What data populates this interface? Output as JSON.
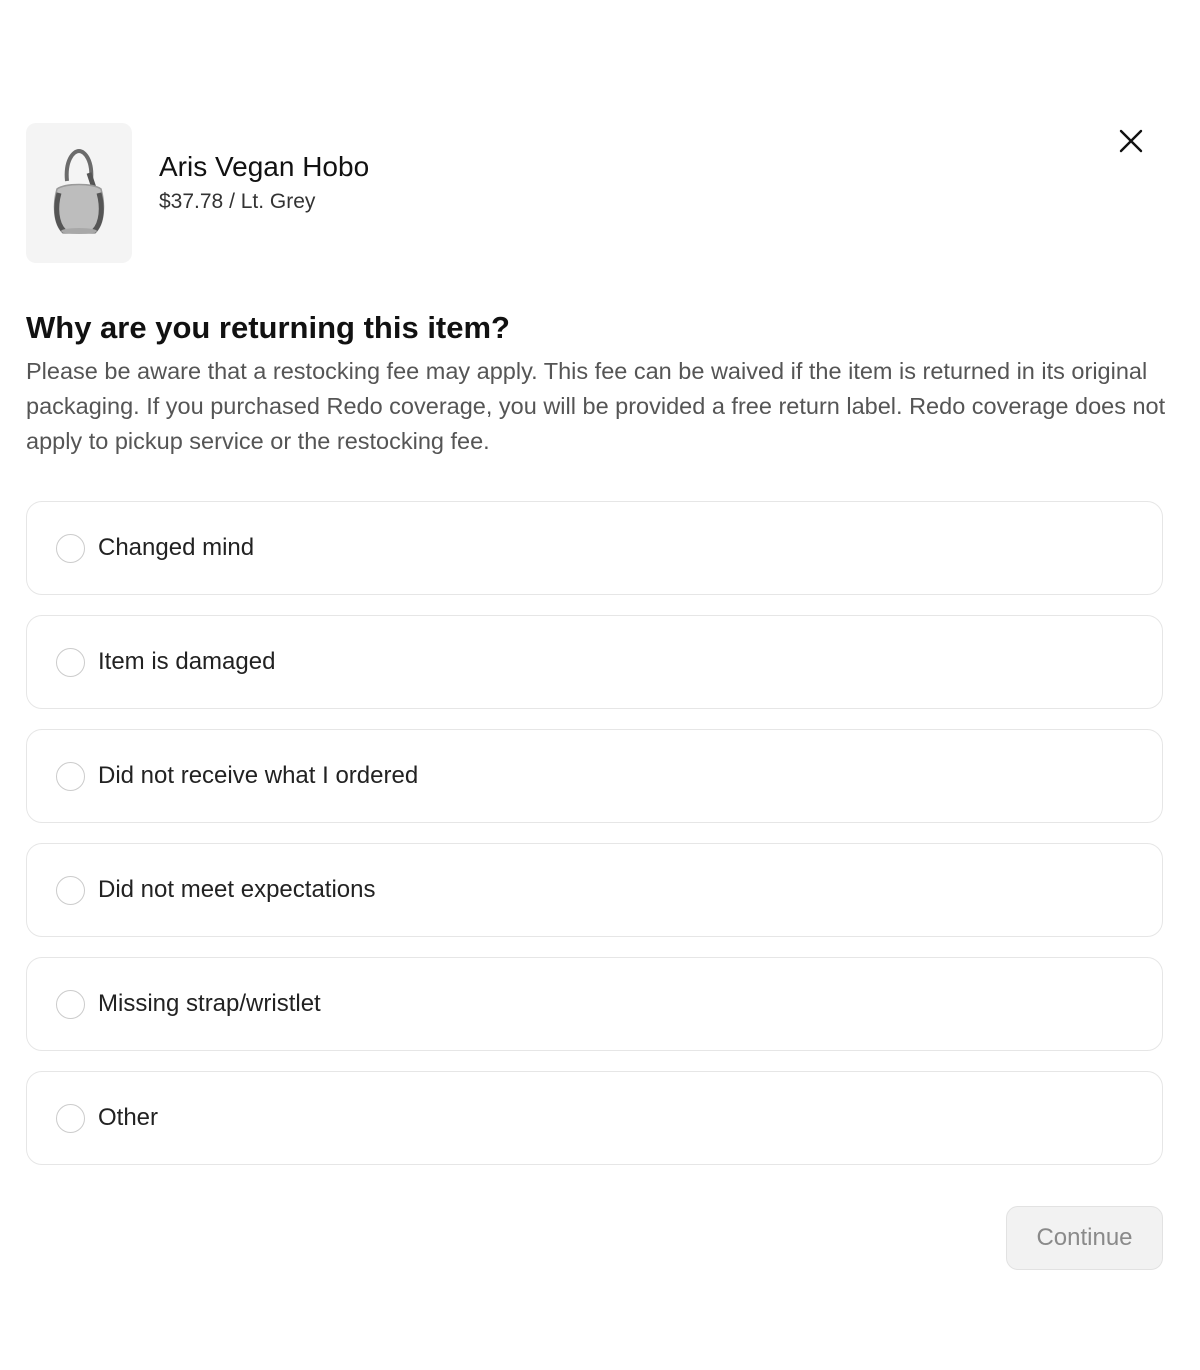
{
  "product": {
    "name": "Aris Vegan Hobo",
    "meta": "$37.78 / Lt. Grey",
    "image_icon": "handbag-icon"
  },
  "close": {
    "icon": "close-icon"
  },
  "question": {
    "heading": "Why are you returning this item?",
    "description": "Please be aware that a restocking fee may apply. This fee can be waived if the item is returned in its original packaging. If you purchased Redo coverage, you will be provided a free return label. Redo coverage does not apply to pickup service or the restocking fee."
  },
  "reasons": [
    {
      "label": "Changed mind"
    },
    {
      "label": "Item is damaged"
    },
    {
      "label": "Did not receive what I ordered"
    },
    {
      "label": "Did not meet expectations"
    },
    {
      "label": "Missing strap/wristlet"
    },
    {
      "label": "Other"
    }
  ],
  "footer": {
    "continue_label": "Continue"
  },
  "colors": {
    "border": "#e6e6e6",
    "thumb_bg": "#f4f4f4",
    "button_bg": "#f2f2f2",
    "button_text": "#8a8a8a"
  }
}
